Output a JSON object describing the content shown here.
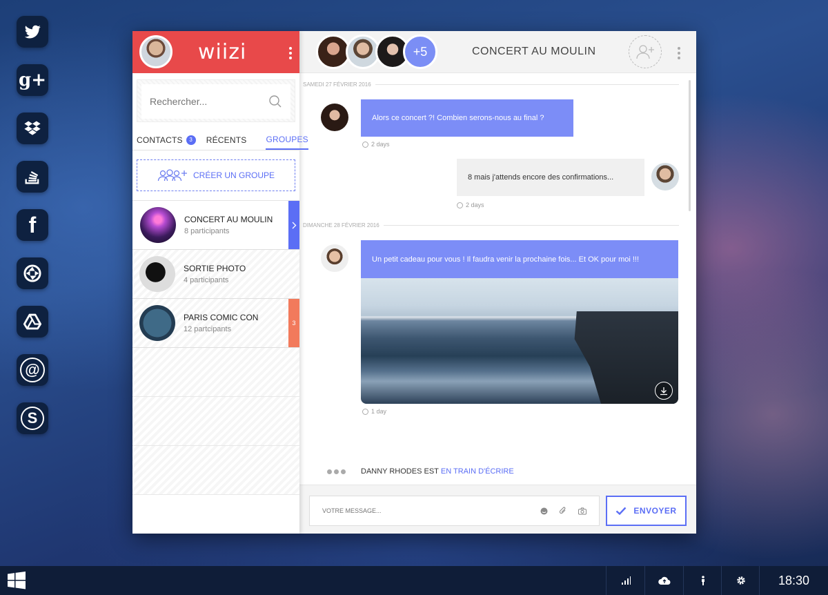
{
  "dock": [
    {
      "name": "twitter",
      "icon": "twitter-icon"
    },
    {
      "name": "google-plus",
      "icon": "google-plus-icon",
      "glyph": "g+"
    },
    {
      "name": "dropbox",
      "icon": "dropbox-icon"
    },
    {
      "name": "stack-overflow",
      "icon": "stack-icon"
    },
    {
      "name": "facebook",
      "icon": "facebook-icon",
      "glyph": "f"
    },
    {
      "name": "picasa",
      "icon": "aperture-icon"
    },
    {
      "name": "drive",
      "icon": "drive-icon"
    },
    {
      "name": "mail",
      "icon": "at-icon",
      "glyph": "@"
    },
    {
      "name": "skype",
      "icon": "skype-icon",
      "glyph": "S"
    }
  ],
  "app": {
    "logo": "wiizi",
    "search": {
      "placeholder": "Rechercher..."
    },
    "tabs": [
      {
        "label": "CONTACTS",
        "badge": "3"
      },
      {
        "label": "RÉCENTS"
      },
      {
        "label": "GROUPES",
        "active": true
      }
    ],
    "create_group_label": "CRÉER UN GROUPE",
    "groups": [
      {
        "name": "CONCERT AU MOULIN",
        "subtitle": "8 participants",
        "active": true
      },
      {
        "name": "SORTIE PHOTO",
        "subtitle": "4 participants"
      },
      {
        "name": "PARIS COMIC CON",
        "subtitle": "12 partcipants",
        "unread": "3"
      }
    ]
  },
  "chat": {
    "title": "CONCERT AU MOULIN",
    "extra_participants": "+5",
    "days": [
      "SAMEDI 27 FÉVRIER 2016",
      "DIMANCHE 28 FÉVRIER 2016"
    ],
    "messages": [
      {
        "text": "Alors ce concert ?! Combien serons-nous au final ?",
        "time": "2 days",
        "direction": "in"
      },
      {
        "text": "8 mais j'attends encore des confirmations...",
        "time": "2 days",
        "direction": "out"
      },
      {
        "text": "Un petit cadeau pour vous ! Il faudra venir la prochaine fois... Et OK pour moi !!!",
        "time": "1 day",
        "direction": "in"
      }
    ],
    "typing": {
      "name": "DANNY RHODES EST",
      "status": "EN TRAIN D'ÉCRIRE"
    },
    "composer": {
      "placeholder": "VOTRE MESSAGE...",
      "send_label": "ENVOYER"
    }
  },
  "taskbar": {
    "clock": "18:30"
  },
  "colors": {
    "brand_red": "#e8494a",
    "accent_blue": "#5b6ef5",
    "bubble_in": "#7c8df7",
    "unread_orange": "#f27a5c"
  }
}
